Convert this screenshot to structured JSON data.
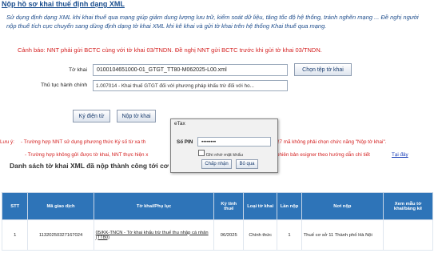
{
  "page": {
    "title": "Nộp hồ sơ khai thuế định dạng XML",
    "description": "Sử dụng định dạng XML khi khai thuế qua mạng giúp giảm dung lượng lưu trữ, kiểm soát dữ liệu, tăng tốc độ hệ thống, tránh nghẽn mạng ... Đề nghị người nộp thuế tích cực chuyển sang dùng định dạng tờ khai XML khi kê khai và gửi tờ khai trên hệ thống Khai thuế qua mạng.",
    "warning": "Cảnh báo: NNT phải gửi BCTC cùng với tờ khai 03/TNDN. Đề nghị NNT gửi BCTC trước khi gửi tờ khai 03/TNDN."
  },
  "form": {
    "file_label": "Tờ khai",
    "file_value": "0100104651000-01_GTGT_TT80-M062025-L00.xml",
    "choose_button": "Chọn tệp tờ khai",
    "procedure_label": "Thủ tục hành chính",
    "procedure_value": "1.007014 - Khai thuế GTGT đối với phương pháp khấu trừ đối với ho...",
    "sign_button": "Ký điện tử",
    "submit_button": "Nộp tờ khai"
  },
  "notes": {
    "prefix": "Lưu ý:",
    "line1a": "- Trường hợp NNT sử dụng phương thức Ký số từ xa th",
    "line1b": "27 mã không phải chọn chức năng \"Nộp tờ khai\".",
    "line2a": "- Trường hợp không gửi được tờ khai, NNT thực hiện x",
    "line2b": "phiên bản esigner theo hướng dẫn chi tiết",
    "link": "Tại đây"
  },
  "list": {
    "title": "Danh sách tờ khai XML đã nộp thành công tới cơ q"
  },
  "table": {
    "headers": [
      "STT",
      "Mã giao dịch",
      "Tờ khai/Phụ lục",
      "Kỳ tính thuế",
      "Loại tờ khai",
      "Lần nộp",
      "Nơi nộp",
      "Xem mẫu tờ khai/bảng kê"
    ],
    "rows": [
      {
        "stt": "1",
        "code": "11320250327167024",
        "form": "05/KK-TNCN - Tờ khai khấu trừ thuế thu nhập cá nhân (TT80)",
        "period": "06/2025",
        "type": "Chính thức",
        "times": "1",
        "place": "Thuế cơ sở 11 Thành phố Hà Nội",
        "view": ""
      }
    ]
  },
  "dialog": {
    "title": "eTax",
    "pin_label": "Số PIN",
    "pin_value": "••••••••",
    "remember_label": "Ghi nhớ mật khẩu",
    "ok_button": "Chấp nhận",
    "cancel_button": "Bỏ qua"
  },
  "colors": {
    "table_header": "#2e74b8",
    "warning": "#d42020",
    "title": "#1b4f8f"
  }
}
